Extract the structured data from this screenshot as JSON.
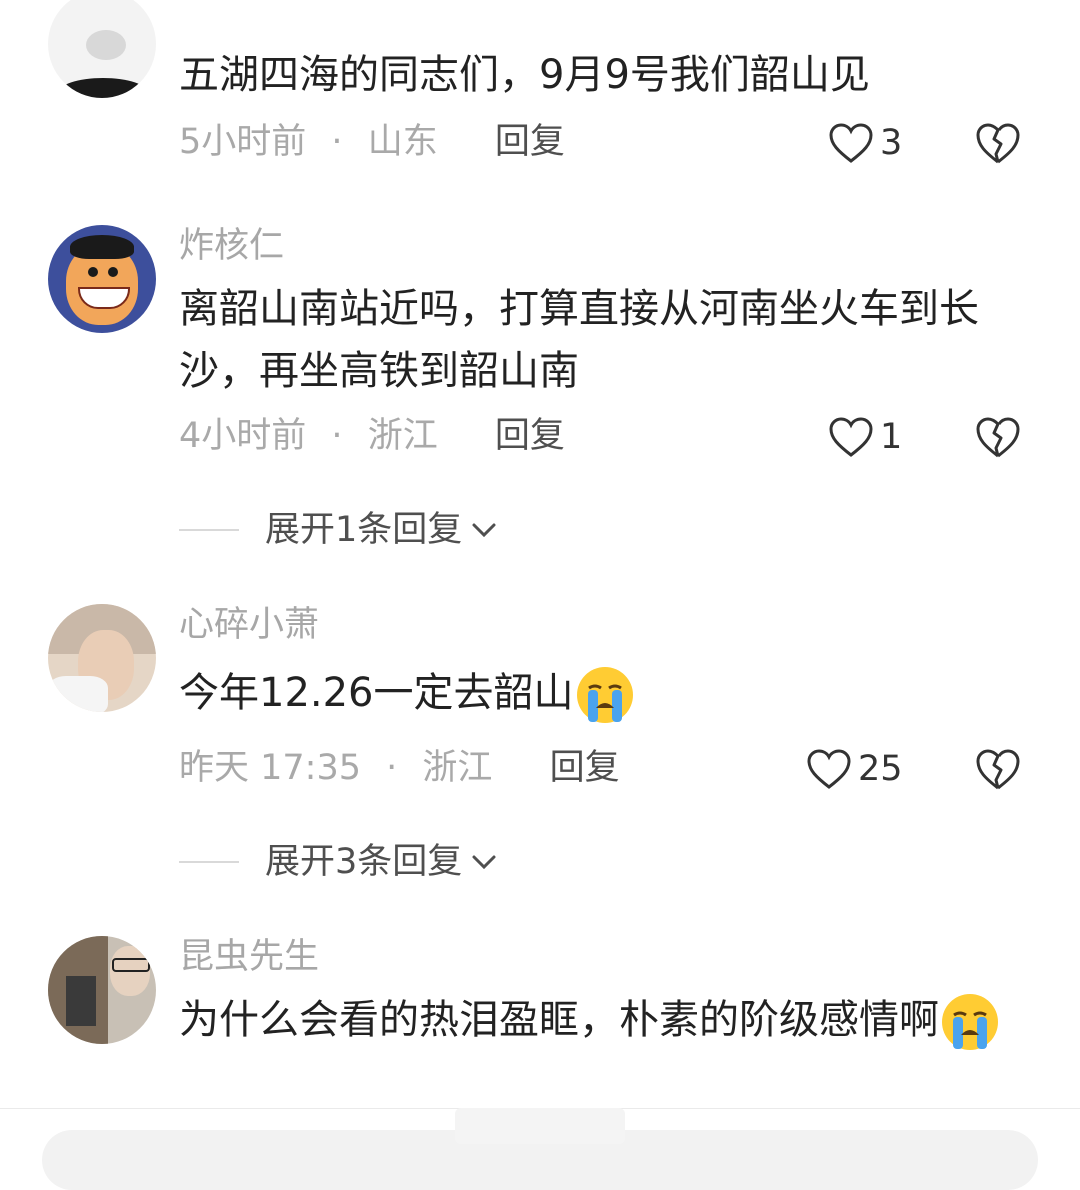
{
  "comments": [
    {
      "username": "",
      "content": "五湖四海的同志们，9月9号我们韶山见",
      "time": "5小时前",
      "location": "山东",
      "reply_label": "回复",
      "likes": "3",
      "avatar_colors": [
        "#f3f3f3",
        "#1a1a1a"
      ]
    },
    {
      "username": "炸核仁",
      "content": "离韶山南站近吗，打算直接从河南坐火车到长沙，再坐高铁到韶山南",
      "time": "4小时前",
      "location": "浙江",
      "reply_label": "回复",
      "likes": "1",
      "expand_label": "展开1条回复",
      "avatar_colors": [
        "#3d4f9c",
        "#f2a65a"
      ]
    },
    {
      "username": "心碎小萧",
      "content": "今年12.26一定去韶山",
      "time": "昨天 17:35",
      "location": "浙江",
      "reply_label": "回复",
      "likes": "25",
      "expand_label": "展开3条回复",
      "avatar_colors": [
        "#c9b8a8",
        "#e5d6c6"
      ]
    },
    {
      "username": "昆虫先生",
      "content": "为什么会看的热泪盈眶，朴素的阶级感情啊",
      "avatar_colors": [
        "#7b6a58",
        "#c8c0b5"
      ]
    }
  ],
  "separator": "·",
  "icons": {
    "like": "heart-outline-icon",
    "dislike": "broken-heart-icon",
    "expand": "chevron-down-icon",
    "emoji": "loudly-crying-face-emoji"
  },
  "colors": {
    "meta_text": "#a9a9a9",
    "username_text": "#a7a7a7",
    "content_text": "#222222"
  }
}
